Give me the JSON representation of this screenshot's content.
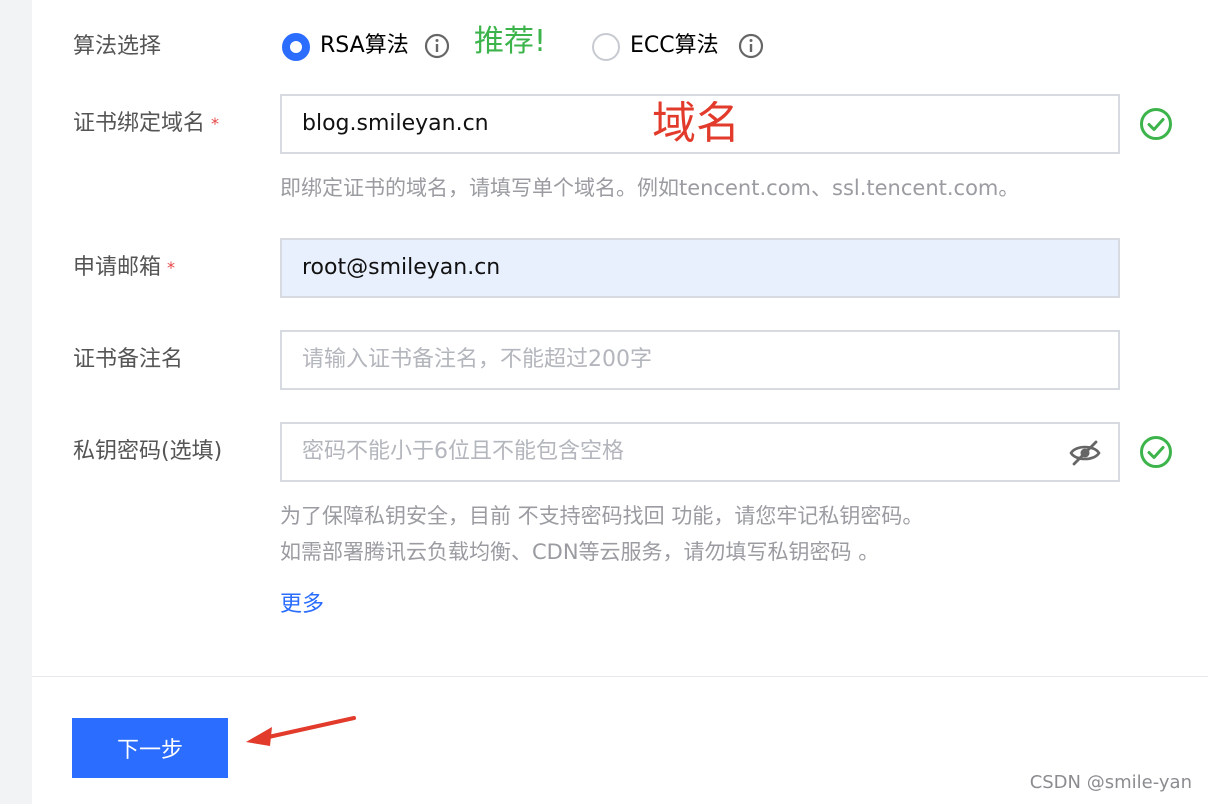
{
  "form": {
    "algorithm": {
      "label": "算法选择",
      "options": [
        {
          "label": "RSA算法",
          "selected": true
        },
        {
          "label": "ECC算法",
          "selected": false
        }
      ],
      "icon": "info-icon"
    },
    "domain": {
      "label": "证书绑定域名",
      "required_mark": "*",
      "value": "blog.smileyan.cn",
      "hint": "即绑定证书的域名，请填写单个域名。例如tencent.com、ssl.tencent.com。",
      "status_icon": "check-circle-icon"
    },
    "email": {
      "label": "申请邮箱",
      "required_mark": "*",
      "value": "root@smileyan.cn"
    },
    "remark": {
      "label": "证书备注名",
      "placeholder": "请输入证书备注名，不能超过200字"
    },
    "password": {
      "label": "私钥密码(选填)",
      "placeholder": "密码不能小于6位且不能包含空格",
      "toggle_icon": "eye-off-icon",
      "status_icon": "check-circle-icon",
      "hint_line1": "为了保障私钥安全，目前 不支持密码找回 功能，请您牢记私钥密码。",
      "hint_line2": "如需部署腾讯云负载均衡、CDN等云服务，请勿填写私钥密码 。",
      "more_link": "更多"
    },
    "next_button": "下一步"
  },
  "annotations": {
    "recommend": "推荐!",
    "domain_note": "域名"
  },
  "watermark": "CSDN @smile-yan",
  "colors": {
    "primary": "#2a6dff",
    "success": "#3cb44b",
    "annotation_red": "#e23b2b",
    "required": "#e54545"
  }
}
